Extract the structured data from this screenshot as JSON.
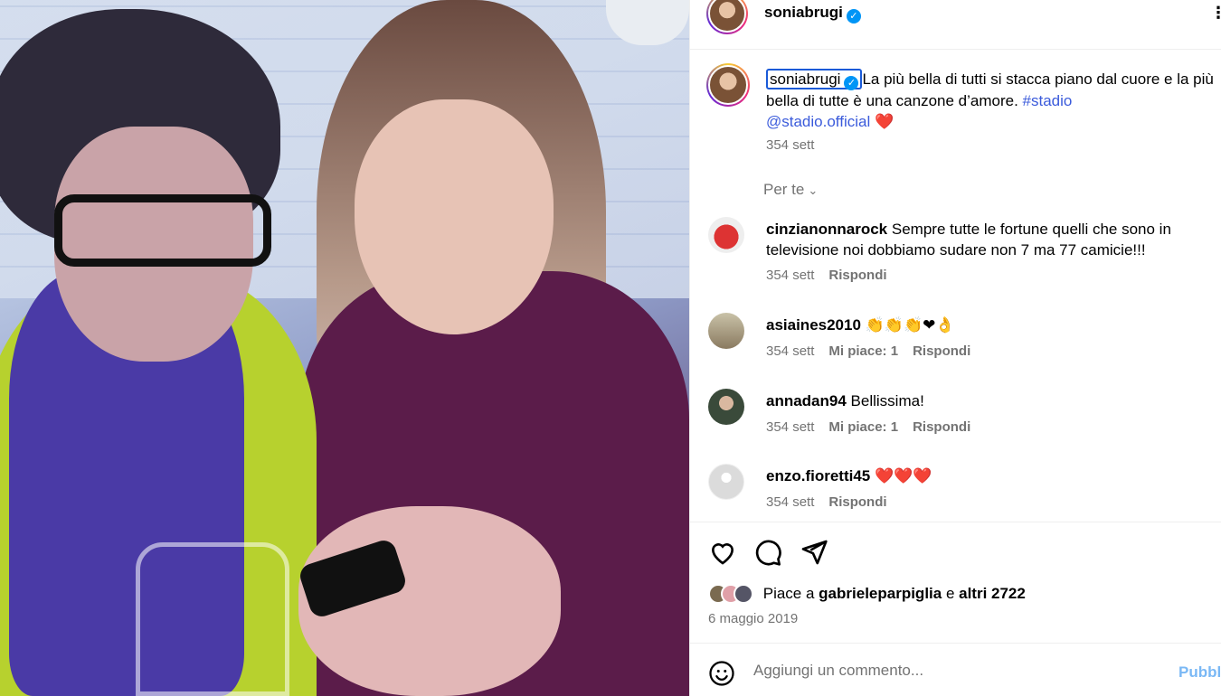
{
  "post": {
    "username": "soniabrugi",
    "verified_mark": "✓",
    "more_icon": "⋮",
    "caption": {
      "text_before": "La più bella di tutti si stacca piano dal cuore e la più bella di tutte è una canzone d’amore. ",
      "hashtag": "#stadio",
      "mention": "@stadio.official",
      "emoji": "❤️",
      "age": "354 sett"
    },
    "for_you": "Per te",
    "for_you_chevron": "⌄"
  },
  "comments": [
    {
      "username": "cinzianonnarock",
      "text": "Sempre tutte le fortune quelli che sono in televisione noi dobbiamo sudare non 7 ma 77 camicie!!!",
      "age": "354 sett",
      "likes": "",
      "reply": "Rispondi",
      "avatar_color": "#d33"
    },
    {
      "username": "asiaines2010",
      "text": "👏👏👏❤👌",
      "age": "354 sett",
      "likes": "Mi piace: 1",
      "reply": "Rispondi",
      "avatar_color": "#8a7a60"
    },
    {
      "username": "annadan94",
      "text": "Bellissima!",
      "age": "354 sett",
      "likes": "Mi piace: 1",
      "reply": "Rispondi",
      "avatar_color": "#3a4a3a"
    },
    {
      "username": "enzo.fioretti45",
      "text": "❤️❤️❤️",
      "age": "354 sett",
      "likes": "",
      "reply": "Rispondi",
      "avatar_color": "#dbdbdb"
    }
  ],
  "actions": {
    "like_icon": "heart-icon",
    "comment_icon": "comment-icon",
    "share_icon": "send-icon"
  },
  "likes": {
    "prefix": "Piace a ",
    "user": "gabrieleparpiglia",
    "middle": " e ",
    "others": "altri 2722"
  },
  "date": "6 maggio 2019",
  "add_comment": {
    "placeholder": "Aggiungi un commento...",
    "publish": "Pubblica"
  },
  "colors": {
    "link": "#3b5bdb",
    "verified": "#0095f6",
    "muted": "#737373"
  }
}
